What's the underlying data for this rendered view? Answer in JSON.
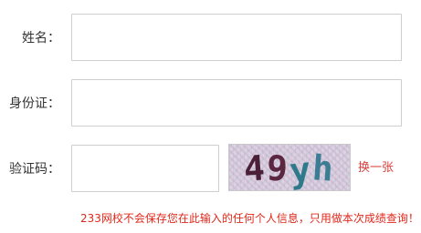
{
  "form": {
    "name_label": "姓名：",
    "id_label": "身份证：",
    "captcha_label": "验证码：",
    "name_value": "",
    "id_value": "",
    "captcha_value": ""
  },
  "captcha": {
    "chars": [
      "4",
      "9",
      "y",
      "h"
    ],
    "refresh_label": "换一张"
  },
  "notice": "233网校不会保存您在此输入的任何个人信息，只用做本次成绩查询！",
  "colors": {
    "accent_red": "#e0281c",
    "captcha_char_4": "#4a1f38",
    "captcha_char_9": "#5a2640",
    "captcha_char_y": "#2e7a8a",
    "captcha_char_h": "#3d7d93"
  }
}
